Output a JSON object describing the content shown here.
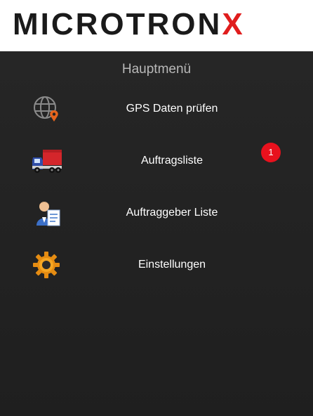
{
  "header": {
    "logo_main": "MICROTRON",
    "logo_accent": "X"
  },
  "main": {
    "title": "Hauptmenü",
    "menu": [
      {
        "label": "GPS Daten prüfen",
        "icon": "globe-location-icon"
      },
      {
        "label": "Auftragsliste",
        "icon": "truck-icon"
      },
      {
        "label": "Auftraggeber Liste",
        "icon": "person-document-icon"
      },
      {
        "label": "Einstellungen",
        "icon": "gear-icon"
      }
    ],
    "badge_count": "1"
  },
  "colors": {
    "background": "#232323",
    "header": "#ffffff",
    "brand_accent": "#e01d1d",
    "badge": "#e8111d"
  }
}
